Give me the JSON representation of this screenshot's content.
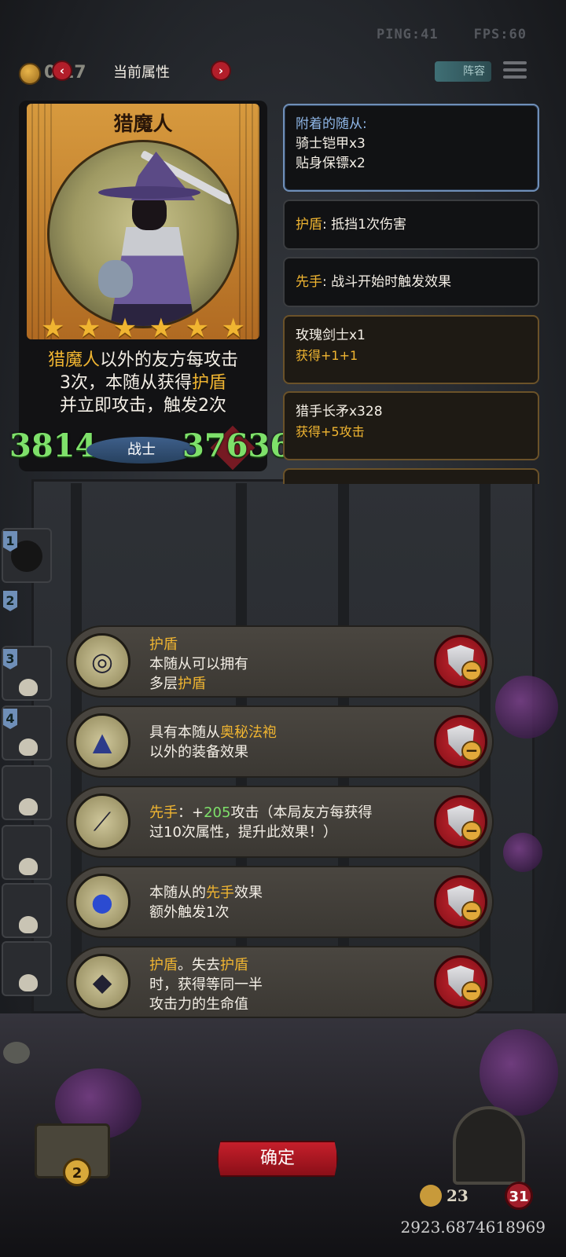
{
  "hud": {
    "ping": "PING:41",
    "fps": "FPS:60",
    "coins": "0 17",
    "page_title": "当前属性",
    "prev": "‹",
    "next": "›",
    "lineup": "阵容"
  },
  "card": {
    "name": "猎魔人",
    "stars": "★★★★★★",
    "desc": {
      "part1": "猎魔人",
      "part2": "以外的友方每攻击",
      "part3": "3次，本随从获得",
      "part4": "护盾",
      "part5": "并立即攻击，触发2次"
    },
    "attack": "3814",
    "health": "37636",
    "class": "战士"
  },
  "info": {
    "attached_title": "附着的随从:",
    "attached_items": [
      "骑士铠甲x3",
      "贴身保镖x2"
    ],
    "shield_key": "护盾",
    "shield_text": ": 抵挡1次伤害",
    "first_key": "先手",
    "first_text": ": 战斗开始时触发效果",
    "buffs": [
      {
        "name": "玫瑰剑士x1",
        "gain": "获得+1+1"
      },
      {
        "name": "猎手长矛x328",
        "gain": "获得+5攻击"
      }
    ]
  },
  "slots": [
    "1",
    "2",
    "3",
    "4"
  ],
  "equipment": [
    {
      "icon": "mirror-icon",
      "line1_y": "护盾",
      "line2": "本随从可以拥有",
      "line3a": "多层",
      "line3b": "护盾"
    },
    {
      "icon": "robe-icon",
      "line1a": "具有本随从",
      "line1b": "奥秘法袍",
      "line2": "以外的装备效果"
    },
    {
      "icon": "spear-icon",
      "line1a": "先手",
      "line1b": "：+",
      "line1c": "205",
      "line1d": "攻击（本局友方每获得",
      "line2": "过10次属性，提升此效果！）"
    },
    {
      "icon": "orb-icon",
      "line1a": "本随从的",
      "line1b": "先手",
      "line1c": "效果",
      "line2": "额外触发1次"
    },
    {
      "icon": "mask-icon",
      "line1a": "护盾",
      "line1b": "。失去",
      "line1c": "护盾",
      "line2": "时，获得等同一半",
      "line3": "攻击力的生命值"
    }
  ],
  "bottom": {
    "confirm": "确定",
    "gold_level": "2",
    "trophies": "23",
    "lives": "31",
    "coords": "2923.6874618969"
  },
  "colors": {
    "accent_gold": "#f0b531",
    "stat_green": "#7ee06a",
    "button_red": "#c61f2b",
    "panel_border_blue": "#6f8fb8"
  }
}
